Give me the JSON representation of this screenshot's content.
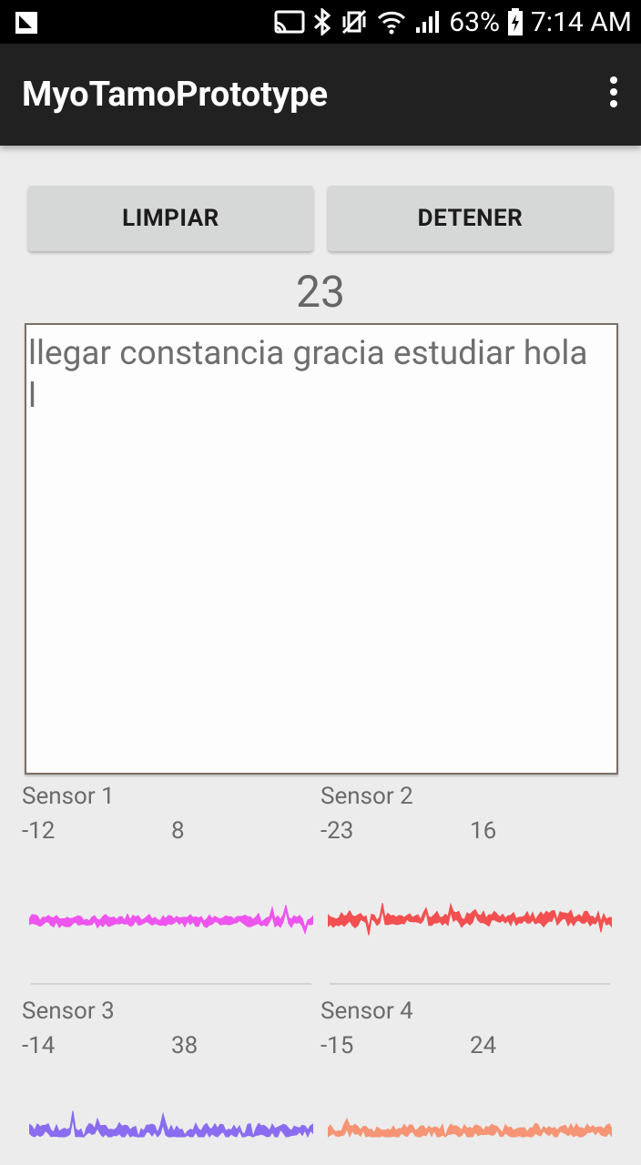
{
  "status_bar": {
    "battery": "63%",
    "time": "7:14 AM"
  },
  "app_bar": {
    "title": "MyoTamoPrototype"
  },
  "buttons": {
    "clear_label": "LIMPIAR",
    "stop_label": "DETENER"
  },
  "counter": "23",
  "output_text": "llegar constancia gracia estudiar hola l",
  "sensors": [
    {
      "label": "Sensor 1",
      "min": "-12",
      "max": "8",
      "color": "#ee55ee"
    },
    {
      "label": "Sensor 2",
      "min": "-23",
      "max": "16",
      "color": "#f25050"
    },
    {
      "label": "Sensor 3",
      "min": "-14",
      "max": "38",
      "color": "#8a6cf0"
    },
    {
      "label": "Sensor 4",
      "min": "-15",
      "max": "24",
      "color": "#f59575"
    }
  ]
}
